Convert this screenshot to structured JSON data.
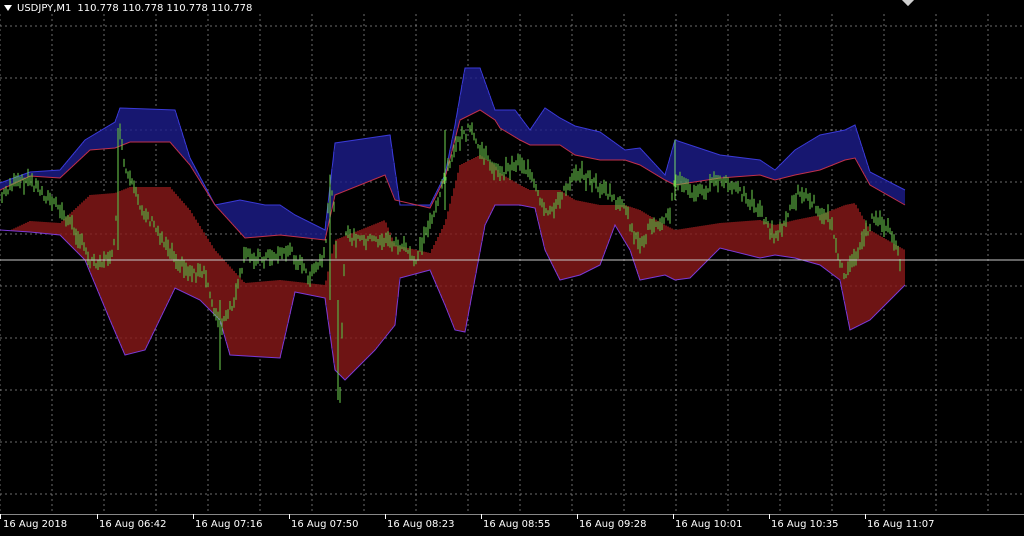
{
  "header": {
    "symbol": "USDJPY,M1",
    "ohlc": [
      "110.778",
      "110.778",
      "110.778",
      "110.778"
    ]
  },
  "time_axis": {
    "labels": [
      "16 Aug 2018",
      "16 Aug 06:42",
      "16 Aug 07:16",
      "16 Aug 07:50",
      "16 Aug 08:23",
      "16 Aug 08:55",
      "16 Aug 09:28",
      "16 Aug 10:01",
      "16 Aug 10:35",
      "16 Aug 11:07"
    ]
  },
  "colors": {
    "background": "#000000",
    "grid": "#9a9a9a",
    "price": "#6fd34f",
    "upper_band": "#1d1d8c",
    "lower_band": "#8a1a1a",
    "mid_line": "#c0304a",
    "level": "#c8c8c8"
  },
  "indicators": {
    "bid_line": true
  }
}
